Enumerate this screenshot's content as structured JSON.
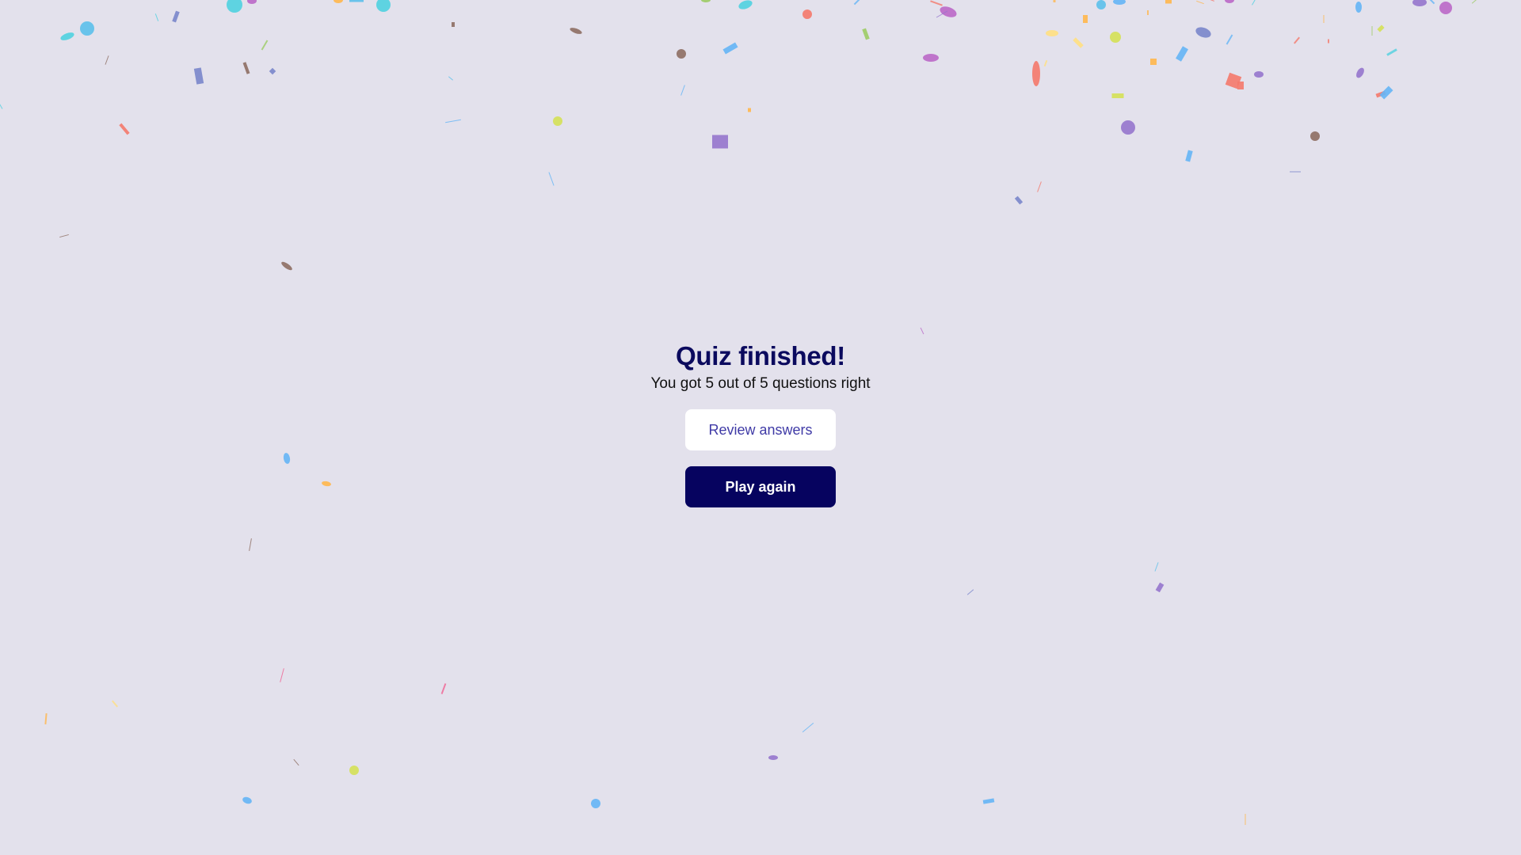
{
  "result": {
    "title": "Quiz finished!",
    "score_text": "You got 5 out of 5 questions right"
  },
  "actions": {
    "review_label": "Review answers",
    "play_again_label": "Play again"
  },
  "colors": {
    "background": "#e3e1ec",
    "title": "#0b0a5e",
    "primary_button": "#06035f",
    "secondary_button_text": "#3f3aa6",
    "confetti_palette": [
      "#5bc0eb",
      "#4fd1e0",
      "#7986cb",
      "#9575cd",
      "#ba68c8",
      "#f4796b",
      "#ffb74d",
      "#ffe082",
      "#d4e157",
      "#9ccc65",
      "#8d6e63",
      "#64b5f6",
      "#f06292"
    ]
  }
}
